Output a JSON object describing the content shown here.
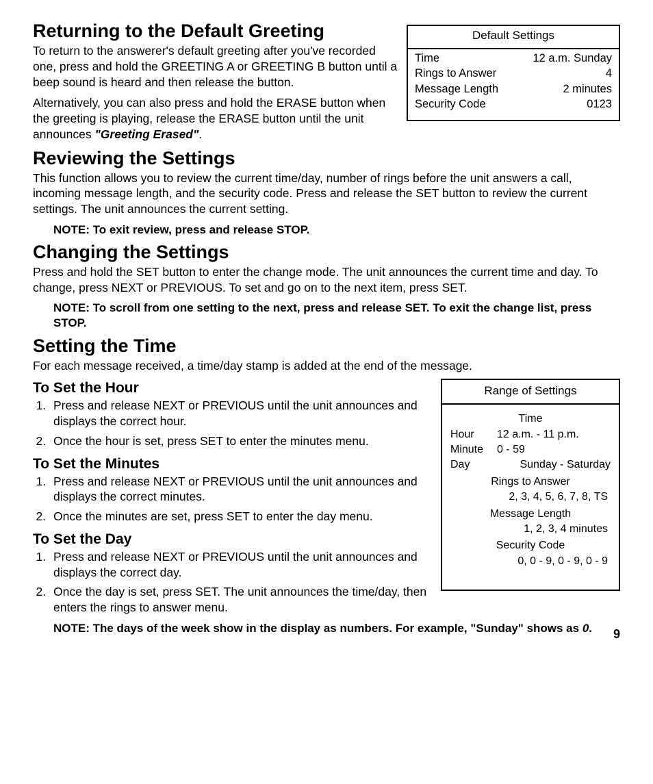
{
  "pagenum": "9",
  "s1": {
    "h": "Returning to the Default Greeting",
    "p1": "To return to the answerer's default greeting after you've recorded one, press and hold the GREETING A or GREETING B button until a beep sound is heard and then release the button.",
    "p2a": "Alternatively, you can also press and hold the ERASE button when the greeting is playing, release the ERASE button until the unit announces ",
    "p2b": "\"Greeting Erased\"",
    "p2c": "."
  },
  "default_table": {
    "title": "Default Settings",
    "rows": [
      {
        "k": "Time",
        "v": "12 a.m. Sunday"
      },
      {
        "k": "Rings to Answer",
        "v": "4"
      },
      {
        "k": "Message Length",
        "v": "2 minutes"
      },
      {
        "k": "Security Code",
        "v": "0123"
      }
    ]
  },
  "s2": {
    "h": "Reviewing the Settings",
    "p1": "This function allows you to review the current time/day, number of rings before the unit answers a call, incoming message length, and the security code. Press and release the SET button to review the current settings. The unit announces the current setting.",
    "note": "NOTE: To exit review, press and release STOP."
  },
  "s3": {
    "h": "Changing the Settings",
    "p1": "Press and hold the SET button to enter the change mode. The unit announces the current time and day. To change, press NEXT or PREVIOUS. To set and go on to the next item, press SET.",
    "note": "NOTE: To scroll from one setting to the next, press and release SET. To exit the change list, press STOP."
  },
  "s4": {
    "h": "Setting the Time",
    "p1": "For each message received, a time/day stamp is added  at the end of the message."
  },
  "range_table": {
    "title": "Range of Settings",
    "time_label": "Time",
    "hour": {
      "k": "Hour",
      "v": "12 a.m. - 11 p.m."
    },
    "minute": {
      "k": "Minute",
      "v": "0 - 59"
    },
    "day": {
      "k": "Day",
      "v": "Sunday - Saturday"
    },
    "rings_label": "Rings to Answer",
    "rings_val": "2, 3, 4, 5, 6, 7, 8, TS",
    "msg_label": "Message Length",
    "msg_val": "1, 2, 3, 4 minutes",
    "sec_label": "Security Code",
    "sec_val": "0, 0 - 9, 0 - 9, 0 - 9"
  },
  "hour": {
    "h": "To Set the Hour",
    "li1": "Press and release NEXT or PREVIOUS until the unit announces and displays the correct hour.",
    "li2": "Once the hour is set, press SET to enter the minutes menu."
  },
  "minutes": {
    "h": "To Set the Minutes",
    "li1": "Press and release NEXT or PREVIOUS until the unit announces and displays the correct minutes.",
    "li2": "Once the minutes are set, press SET to enter the day menu."
  },
  "day": {
    "h": "To Set the Day",
    "li1": "Press and release NEXT or PREVIOUS until the unit announces and displays the correct day.",
    "li2": "Once the day is set, press SET. The unit announces the time/day, then enters the rings to answer menu.",
    "note_a": "NOTE: The days of the week show in the display as numbers. For example, \"Sunday\" shows as ",
    "note_b": "0",
    "note_c": "."
  }
}
